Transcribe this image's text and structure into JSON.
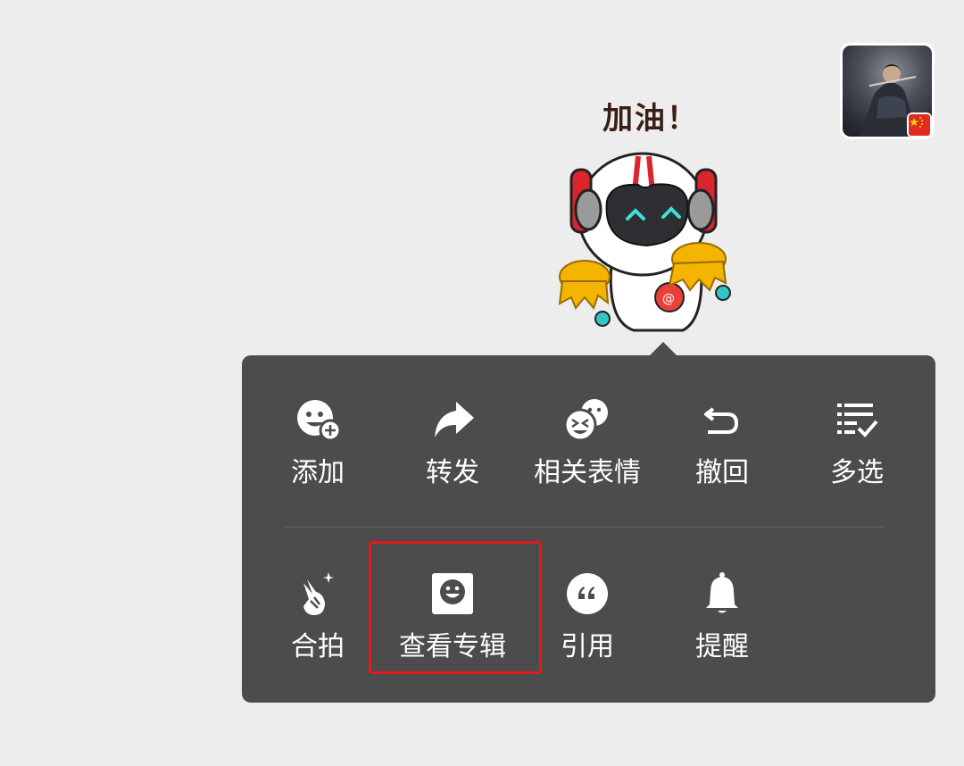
{
  "sticker": {
    "caption": "加油！"
  },
  "menu": {
    "row1": [
      {
        "label": "添加",
        "icon": "add-emoji-icon"
      },
      {
        "label": "转发",
        "icon": "forward-icon"
      },
      {
        "label": "相关表情",
        "icon": "related-stickers-icon"
      },
      {
        "label": "撤回",
        "icon": "recall-icon"
      },
      {
        "label": "多选",
        "icon": "multi-select-icon"
      }
    ],
    "row2": [
      {
        "label": "合拍",
        "icon": "duet-icon"
      },
      {
        "label": "查看专辑",
        "icon": "view-album-icon"
      },
      {
        "label": "引用",
        "icon": "quote-icon"
      },
      {
        "label": "提醒",
        "icon": "bell-icon"
      }
    ]
  },
  "colors": {
    "menu_bg": "#4c4c4c",
    "page_bg": "#ededed",
    "highlight": "#e21a1a"
  }
}
